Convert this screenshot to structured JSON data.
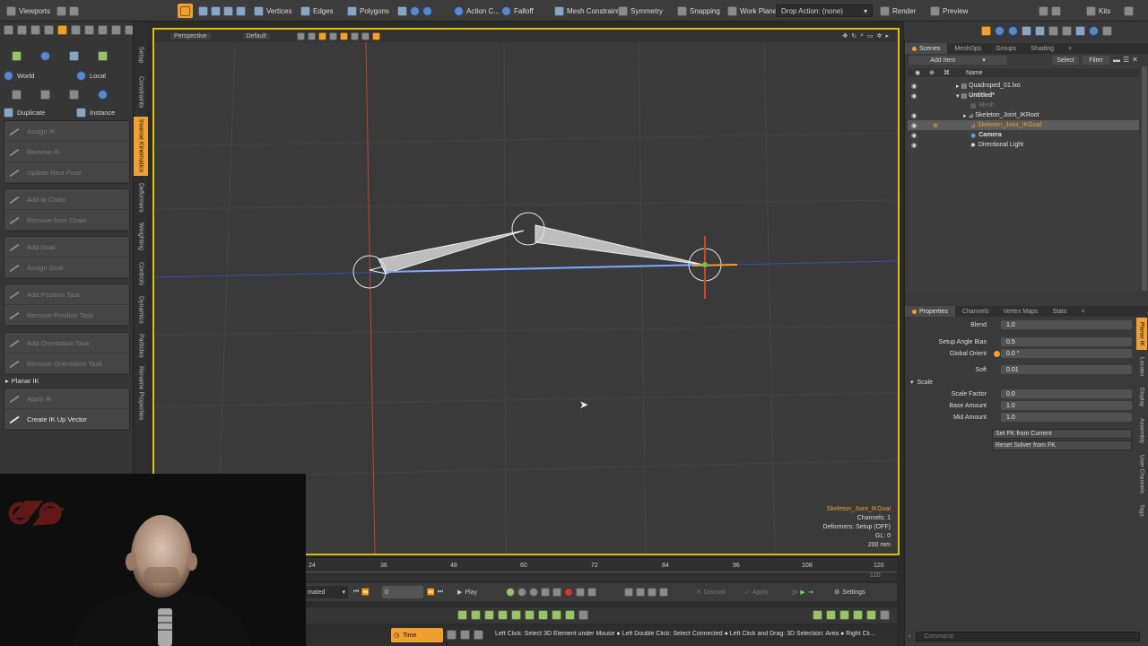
{
  "toolbar": {
    "viewports": "Viewports",
    "vertices": "Vertices",
    "edges": "Edges",
    "polygons": "Polygons",
    "action_center": "Action C...",
    "falloff": "Falloff",
    "mesh_constraint": "Mesh Constraint",
    "symmetry": "Symmetry",
    "snapping": "Snapping",
    "work_plane": "Work Plane",
    "drop_action": "Drop Action: (none)",
    "render": "Render",
    "preview": "Preview",
    "kits": "Kits"
  },
  "left_panel": {
    "world": "World",
    "local": "Local",
    "duplicate": "Duplicate",
    "instance": "Instance",
    "groups": [
      [
        {
          "label": "Assign IK",
          "enabled": false
        },
        {
          "label": "Remove IK",
          "enabled": false
        },
        {
          "label": "Update Rest Pose",
          "enabled": false
        }
      ],
      [
        {
          "label": "Add to Chain",
          "enabled": false
        },
        {
          "label": "Remove from Chain",
          "enabled": false
        }
      ],
      [
        {
          "label": "Add Goal",
          "enabled": false
        },
        {
          "label": "Assign Goal",
          "enabled": false
        }
      ],
      [
        {
          "label": "Add Position Task",
          "enabled": false
        },
        {
          "label": "Remove Position Task",
          "enabled": false
        }
      ],
      [
        {
          "label": "Add Orientation Task",
          "enabled": false
        },
        {
          "label": "Remove Orientation Task",
          "enabled": false
        }
      ]
    ],
    "planar_ik": "Planar IK",
    "planar_buttons": [
      {
        "label": "Apply IK",
        "enabled": false
      },
      {
        "label": "Create IK Up Vector",
        "enabled": true
      }
    ],
    "side_tabs": [
      "Setup",
      "Constraints",
      "Inverse Kinematics",
      "Deformers",
      "Weighting",
      "Controls",
      "Dynamics",
      "Particles",
      "Rename Properties"
    ]
  },
  "viewport": {
    "view_mode": "Perspective",
    "shading": "Default",
    "info": {
      "item": "Skeleton_Joint_IKGoal",
      "channels": "Channels: 1",
      "deformers": "Deformers: Setup (OFF)",
      "gl": "GL: 0",
      "scale": "200 mm"
    }
  },
  "timeline": {
    "ticks": [
      "24",
      "36",
      "48",
      "60",
      "72",
      "84",
      "96",
      "108",
      "120"
    ],
    "end_mark": "120",
    "mode": "mated",
    "frame": "0",
    "play": "Play",
    "discard": "Discard",
    "apply": "Apply",
    "settings": "Settings"
  },
  "status": {
    "time": "Time",
    "hint": "Left Click: Select 3D Element under Mouse ● Left Double Click: Select Connected ● Left Click and Drag: 3D Selection: Area ● Right Cli..."
  },
  "scene_panel": {
    "tabs": [
      "Scenes",
      "MeshOps",
      "Groups",
      "Shading"
    ],
    "add_item": "Add Item",
    "select": "Select",
    "filter": "Filter",
    "col_name": "Name",
    "items": [
      {
        "name": "Quadroped_01.lxo",
        "indent": 0,
        "state": "normal"
      },
      {
        "name": "Untitled*",
        "indent": 0,
        "state": "bold"
      },
      {
        "name": "Mesh",
        "indent": 1,
        "state": "dim"
      },
      {
        "name": "Skeleton_Joint_IKRoot",
        "indent": 1,
        "state": "normal"
      },
      {
        "name": "Skeleton_Joint_IKGoal",
        "indent": 2,
        "state": "selected"
      },
      {
        "name": "Camera",
        "indent": 1,
        "state": "bold"
      },
      {
        "name": "Directional Light",
        "indent": 1,
        "state": "normal"
      }
    ]
  },
  "properties": {
    "tabs": [
      "Properties",
      "Channels",
      "Vertex Maps",
      "Stats"
    ],
    "rows": [
      {
        "label": "Blend",
        "value": "1.0"
      },
      {
        "label": "Setup Angle Bias",
        "value": "0.5"
      },
      {
        "label": "Global Orient",
        "value": "0.0 °"
      },
      {
        "label": "Soft",
        "value": "0.01"
      }
    ],
    "scale_section": "Scale",
    "scale_rows": [
      {
        "label": "Scale Factor",
        "value": "0.0"
      },
      {
        "label": "Base Amount",
        "value": "1.0"
      },
      {
        "label": "Mid Amount",
        "value": "1.0"
      }
    ],
    "buttons": [
      "Set FK from Current",
      "Reset Solver from FK"
    ],
    "side_tabs": [
      "Planar IK",
      "Locator",
      "Display",
      "Assembly",
      "User Channels",
      "Tags"
    ]
  },
  "command": {
    "placeholder": "Command"
  }
}
